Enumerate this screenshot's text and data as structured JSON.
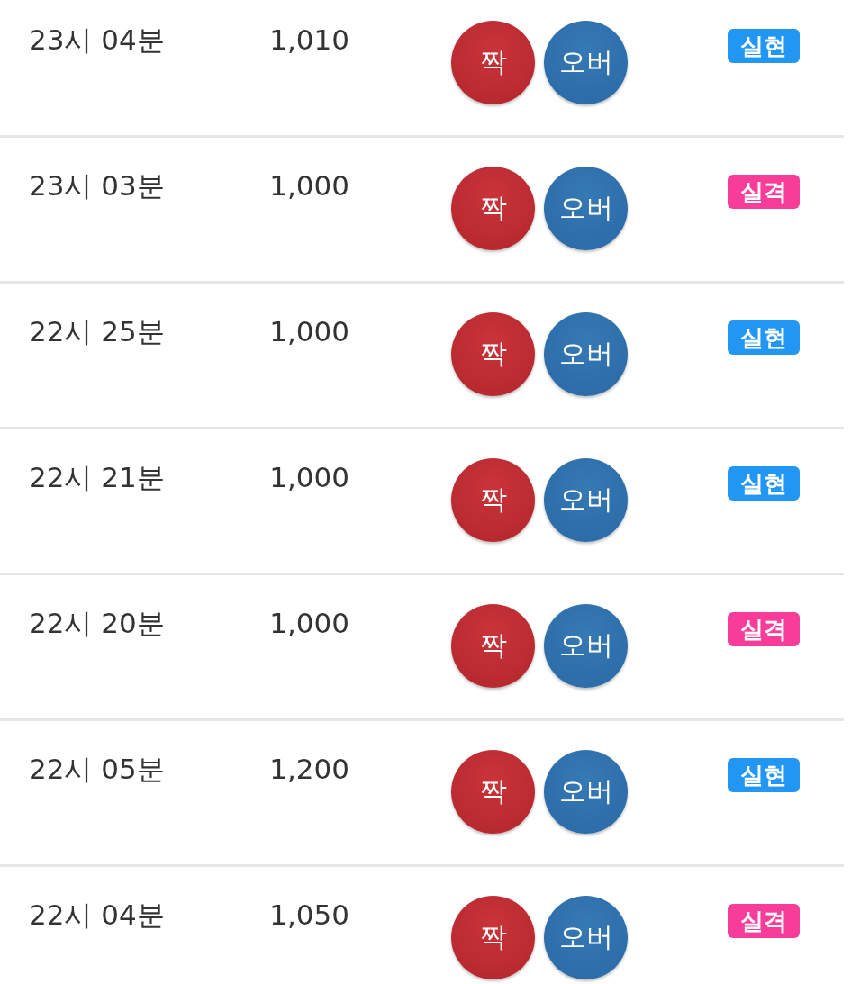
{
  "rows": [
    {
      "time": "23시 04분",
      "amount": "1,010",
      "pick_1": "짝",
      "pick_2": "오버",
      "result": "실현",
      "color": "#2196f3"
    },
    {
      "time": "23시 03분",
      "amount": "1,000",
      "pick_1": "짝",
      "pick_2": "오버",
      "result": "실격",
      "color": "#f73c9a"
    },
    {
      "time": "22시 25분",
      "amount": "1,000",
      "pick_1": "짝",
      "pick_2": "오버",
      "result": "실현",
      "color": "#2196f3"
    },
    {
      "time": "22시 21분",
      "amount": "1,000",
      "pick_1": "짝",
      "pick_2": "오버",
      "result": "실현",
      "color": "#2196f3"
    },
    {
      "time": "22시 20분",
      "amount": "1,000",
      "pick_1": "짝",
      "pick_2": "오버",
      "result": "실격",
      "color": "#f73c9a"
    },
    {
      "time": "22시 05분",
      "amount": "1,200",
      "pick_1": "짝",
      "pick_2": "오버",
      "result": "실현",
      "color": "#2196f3"
    },
    {
      "time": "22시 04분",
      "amount": "1,050",
      "pick_1": "짝",
      "pick_2": "오버",
      "result": "실격",
      "color": "#f73c9a"
    }
  ]
}
